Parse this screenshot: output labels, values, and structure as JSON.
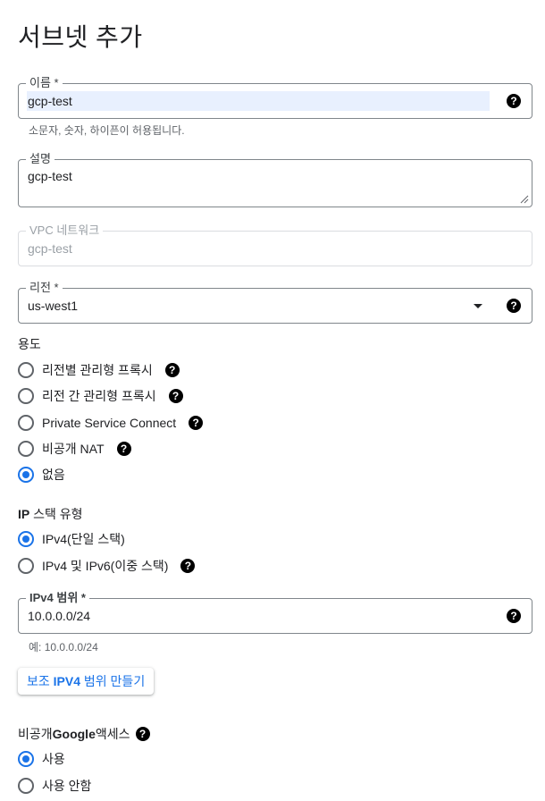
{
  "page": {
    "title": "서브넷 추가"
  },
  "name_field": {
    "label": "이름 *",
    "value": "gcp-test",
    "hint": "소문자, 숫자, 하이픈이 허용됩니다."
  },
  "description_field": {
    "label": "설명",
    "value": "gcp-test"
  },
  "vpc_field": {
    "label": "VPC 네트워크",
    "value": "gcp-test"
  },
  "region_field": {
    "label": "리전 *",
    "value": "us-west1"
  },
  "purpose": {
    "label": "용도",
    "options": [
      {
        "label": "리전별 관리형 프록시",
        "selected": false
      },
      {
        "label": "리전 간 관리형 프록시",
        "selected": false
      },
      {
        "label": "Private Service Connect",
        "selected": false
      },
      {
        "label": "비공개 NAT",
        "selected": false
      },
      {
        "label": "없음",
        "selected": true
      }
    ]
  },
  "ip_stack": {
    "label_prefix": "IP",
    "label_suffix": " 스택 유형",
    "options": [
      {
        "label": "IPv4(단일 스택)",
        "selected": true
      },
      {
        "label": "IPv4 및 IPv6(이중 스택)",
        "selected": false
      }
    ]
  },
  "ipv4_range": {
    "label": "IPv4 범위 *",
    "value": "10.0.0.0/24",
    "hint": "예: 10.0.0.0/24"
  },
  "add_secondary": {
    "label_prefix": "보조 ",
    "label_bold": "IPV4",
    "label_suffix": " 범위 만들기"
  },
  "private_google_access": {
    "label_prefix": "비공개 ",
    "label_bold": "Google",
    "label_suffix": " 액세스",
    "options": [
      {
        "label": "사용",
        "selected": true
      },
      {
        "label": "사용 안함",
        "selected": false
      }
    ]
  },
  "icons": {
    "help": "help-circle-icon",
    "dropdown": "arrow-drop-down-icon",
    "resize": "resize-handle-icon"
  },
  "colors": {
    "accent": "#1a73e8",
    "border": "#80868b",
    "highlight": "#e8f0fe"
  }
}
